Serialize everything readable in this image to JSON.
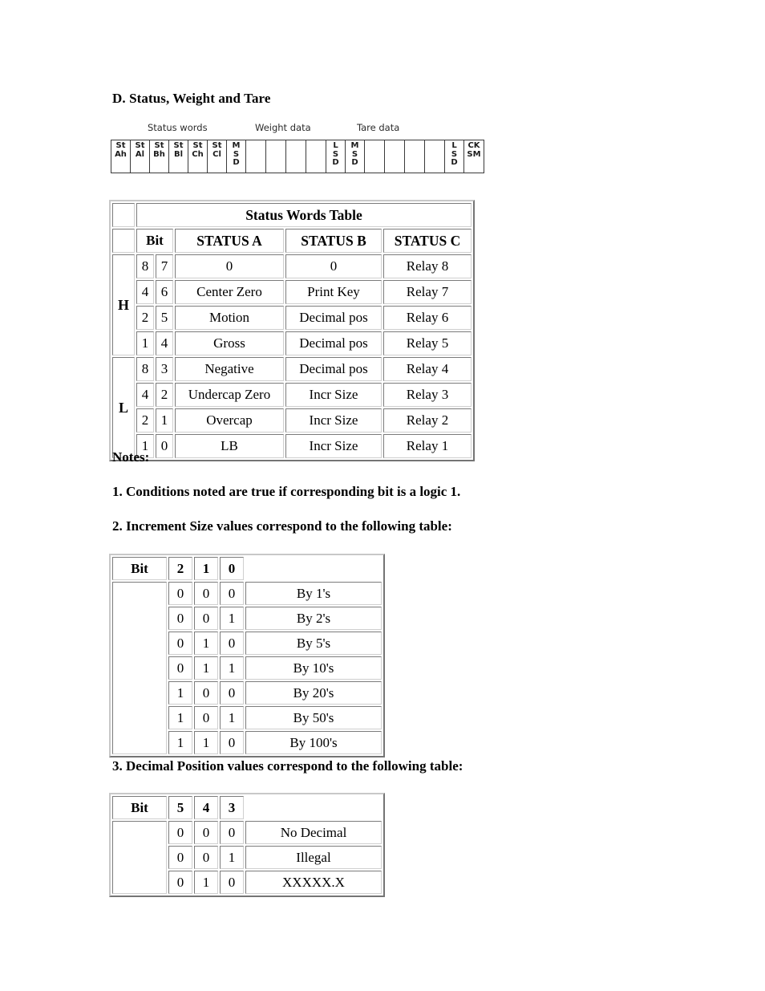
{
  "document": {
    "section_heading": "D. Status, Weight and Tare"
  },
  "byte_diagram": {
    "group_labels": {
      "status_words": "Status words",
      "weight_data": "Weight data",
      "tare_data": "Tare data"
    },
    "cells": [
      {
        "lines": [
          "St",
          "Ah"
        ]
      },
      {
        "lines": [
          "St",
          "Al"
        ]
      },
      {
        "lines": [
          "St",
          "Bh"
        ]
      },
      {
        "lines": [
          "St",
          "Bl"
        ]
      },
      {
        "lines": [
          "St",
          "Ch"
        ]
      },
      {
        "lines": [
          "St",
          "Cl"
        ]
      },
      {
        "lines": [
          "M",
          "S",
          "D"
        ]
      },
      {
        "lines": []
      },
      {
        "lines": []
      },
      {
        "lines": []
      },
      {
        "lines": []
      },
      {
        "lines": [
          "L",
          "S",
          "D"
        ]
      },
      {
        "lines": [
          "M",
          "S",
          "D"
        ]
      },
      {
        "lines": []
      },
      {
        "lines": []
      },
      {
        "lines": []
      },
      {
        "lines": []
      },
      {
        "lines": [
          "L",
          "S",
          "D"
        ]
      },
      {
        "lines": [
          "CK",
          "SM"
        ]
      }
    ]
  },
  "status_words_table": {
    "title": "Status Words Table",
    "headers": {
      "bit": "Bit",
      "status_a": "STATUS A",
      "status_b": "STATUS B",
      "status_c": "STATUS C"
    },
    "group_labels": {
      "high": "H",
      "low": "L"
    },
    "rows": [
      {
        "weight": "8",
        "bit": "7",
        "status_a": "0",
        "status_b": "0",
        "status_c": "Relay 8"
      },
      {
        "weight": "4",
        "bit": "6",
        "status_a": "Center Zero",
        "status_b": "Print Key",
        "status_c": "Relay 7"
      },
      {
        "weight": "2",
        "bit": "5",
        "status_a": "Motion",
        "status_b": "Decimal pos",
        "status_c": "Relay 6"
      },
      {
        "weight": "1",
        "bit": "4",
        "status_a": "Gross",
        "status_b": "Decimal pos",
        "status_c": "Relay 5"
      },
      {
        "weight": "8",
        "bit": "3",
        "status_a": "Negative",
        "status_b": "Decimal pos",
        "status_c": "Relay 4"
      },
      {
        "weight": "4",
        "bit": "2",
        "status_a": "Undercap Zero",
        "status_b": "Incr Size",
        "status_c": "Relay 3"
      },
      {
        "weight": "2",
        "bit": "1",
        "status_a": "Overcap",
        "status_b": "Incr Size",
        "status_c": "Relay 2"
      },
      {
        "weight": "1",
        "bit": "0",
        "status_a": "LB",
        "status_b": "Incr Size",
        "status_c": "Relay 1"
      }
    ]
  },
  "notes": {
    "heading": "Notes:",
    "note_1": "1. Conditions noted are true if corresponding bit is a logic 1.",
    "note_2": "2. Increment Size values correspond to the following table:",
    "note_3": "3. Decimal Position values correspond to the following table:"
  },
  "increment_table": {
    "bit_label": "Bit",
    "bit_columns": [
      "2",
      "1",
      "0"
    ],
    "rows": [
      {
        "bits": [
          "0",
          "0",
          "0"
        ],
        "description": "By 1's"
      },
      {
        "bits": [
          "0",
          "0",
          "1"
        ],
        "description": "By 2's"
      },
      {
        "bits": [
          "0",
          "1",
          "0"
        ],
        "description": "By 5's"
      },
      {
        "bits": [
          "0",
          "1",
          "1"
        ],
        "description": "By 10's"
      },
      {
        "bits": [
          "1",
          "0",
          "0"
        ],
        "description": "By 20's"
      },
      {
        "bits": [
          "1",
          "0",
          "1"
        ],
        "description": "By 50's"
      },
      {
        "bits": [
          "1",
          "1",
          "0"
        ],
        "description": "By 100's"
      }
    ]
  },
  "decimal_table": {
    "bit_label": "Bit",
    "bit_columns": [
      "5",
      "4",
      "3"
    ],
    "rows": [
      {
        "bits": [
          "0",
          "0",
          "0"
        ],
        "description": "No Decimal"
      },
      {
        "bits": [
          "0",
          "0",
          "1"
        ],
        "description": "Illegal"
      },
      {
        "bits": [
          "0",
          "1",
          "0"
        ],
        "description": "XXXXX.X"
      }
    ]
  }
}
